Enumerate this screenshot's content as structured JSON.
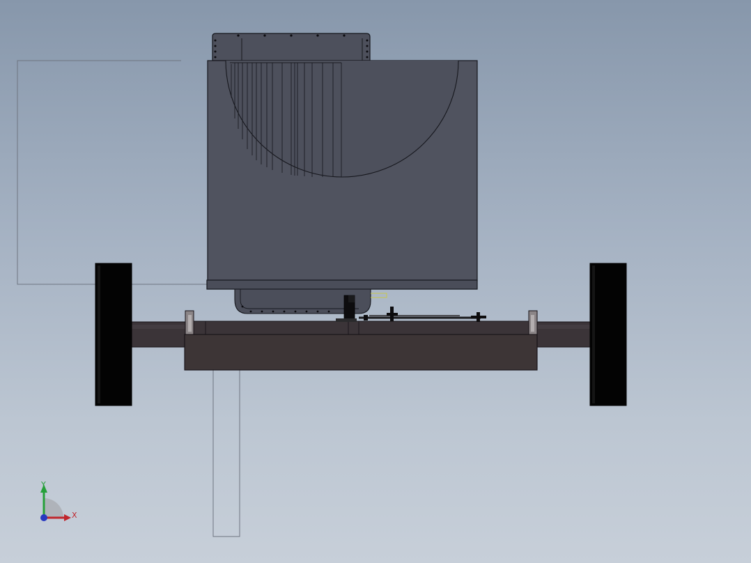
{
  "window": {
    "title": ""
  },
  "viewport": {
    "background_top": "#8797ab",
    "background_bottom": "#c7cfd9",
    "model_colors": {
      "housing": "#50535f",
      "housing_edge": "#1a1b22",
      "wheel": "#030303",
      "axle": "#3b3438",
      "frame": "#3d3536",
      "sketch_line": "#6e7480",
      "sketch_highlight": "#c8c84a"
    }
  },
  "triad": {
    "x_label": "X",
    "y_label": "Y",
    "x_color": "#c0262c",
    "y_color": "#26a03a",
    "z_color": "#2838c0"
  }
}
